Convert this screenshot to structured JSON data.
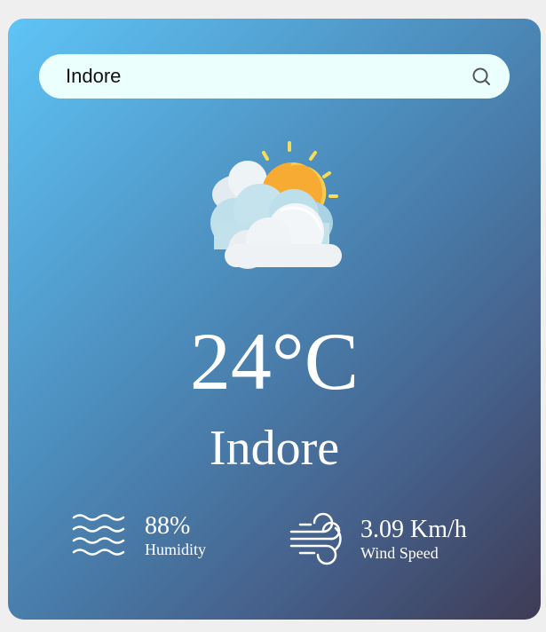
{
  "search": {
    "value": "Indore",
    "icon": "search-icon"
  },
  "weather": {
    "icon": "partly-cloudy-icon",
    "temperature": "24°C",
    "city": "Indore"
  },
  "humidity": {
    "icon": "humidity-icon",
    "value": "88%",
    "label": "Humidity"
  },
  "wind": {
    "icon": "wind-icon",
    "value": "3.09 Km/h",
    "label": "Wind Speed"
  },
  "colors": {
    "gradient_start": "#5ec4f6",
    "gradient_end": "#3f3b55",
    "search_background": "#ebfffc",
    "text": "#ffffff"
  }
}
